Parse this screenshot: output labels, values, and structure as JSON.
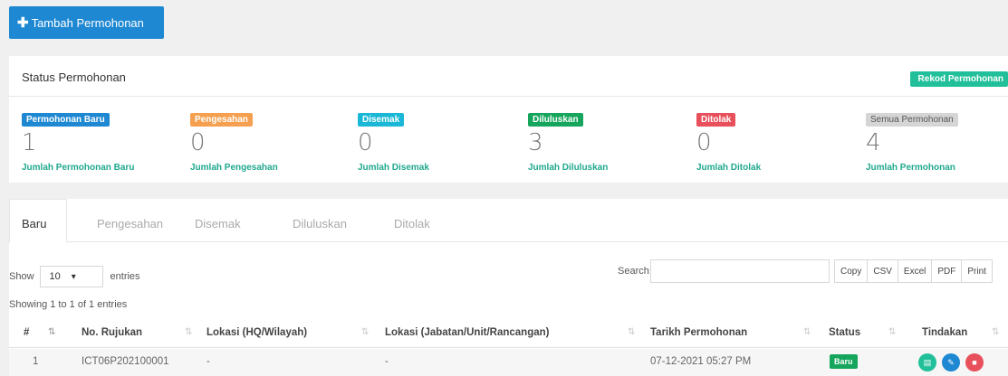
{
  "toolbar": {
    "add_label": "Tambah Permohonan"
  },
  "status": {
    "title": "Status Permohonan",
    "rekod_label": "Rekod Permohonan",
    "stats": [
      {
        "badge": "Permohonan Baru",
        "count": "1",
        "label": "Jumlah Permohonan Baru",
        "color": "#1e88d2"
      },
      {
        "badge": "Pengesahan",
        "count": "0",
        "label": "Jumlah Pengesahan",
        "color": "#f5a050"
      },
      {
        "badge": "Disemak",
        "count": "0",
        "label": "Jumlah Disemak",
        "color": "#1ab8d6"
      },
      {
        "badge": "Diluluskan",
        "count": "3",
        "label": "Jumlah Diluluskan",
        "color": "#16a55c"
      },
      {
        "badge": "Ditolak",
        "count": "0",
        "label": "Jumlah Ditolak",
        "color": "#e8505b"
      },
      {
        "badge": "Semua Permohonan",
        "count": "4",
        "label": "Jumlah Permohonan",
        "color": "#d5d5d5"
      }
    ]
  },
  "tabs": [
    "Baru",
    "Pengesahan",
    "Disemak",
    "Diluluskan",
    "Ditolak"
  ],
  "table_controls": {
    "show_label": "Show",
    "entries_value": "10",
    "entries_label": "entries",
    "search_label": "Search:",
    "search_value": "",
    "export_buttons": [
      "Copy",
      "CSV",
      "Excel",
      "PDF",
      "Print"
    ],
    "showing_text": "Showing 1 to 1 of 1 entries"
  },
  "table": {
    "headers": [
      "#",
      "No. Rujukan",
      "Lokasi (HQ/Wilayah)",
      "Lokasi (Jabatan/Unit/Rancangan)",
      "Tarikh Permohonan",
      "Status",
      "Tindakan"
    ],
    "rows": [
      {
        "no": "1",
        "rujukan": "ICT06P202100001",
        "lokasi_hq": "-",
        "lokasi_jabatan": "-",
        "tarikh": "07-12-2021 05:27 PM",
        "status": "Baru"
      }
    ]
  },
  "actions": [
    {
      "icon": "view-icon",
      "color": "#21c09a"
    },
    {
      "icon": "edit-icon",
      "color": "#1e88d2"
    },
    {
      "icon": "delete-icon",
      "color": "#e8505b"
    }
  ]
}
